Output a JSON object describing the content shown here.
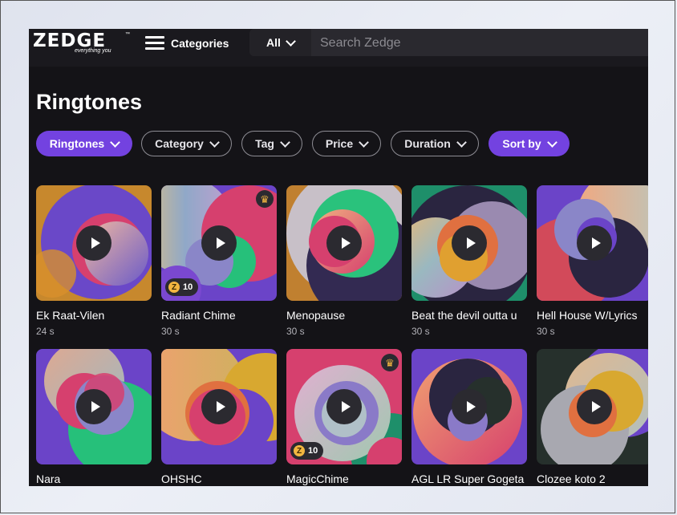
{
  "header": {
    "logo_text": "ZEDGE",
    "logo_tagline": "everything you",
    "logo_tm": "™",
    "categories_label": "Categories",
    "search_scope": "All",
    "search_placeholder": "Search Zedge"
  },
  "page": {
    "title": "Ringtones"
  },
  "filters": [
    "Ringtones",
    "Category",
    "Tag",
    "Price",
    "Duration",
    "Sort by"
  ],
  "colors": {
    "accent": "#7342e0",
    "background": "#141317",
    "coin": "#f2b640"
  },
  "items": [
    {
      "title": "Ek Raat-Vilen",
      "duration": "24 s",
      "premium": false,
      "coins": ""
    },
    {
      "title": "Radiant Chime",
      "duration": "30 s",
      "premium": true,
      "coins": "10"
    },
    {
      "title": "Menopause",
      "duration": "30 s",
      "premium": false,
      "coins": ""
    },
    {
      "title": "Beat the devil outta u",
      "duration": "30 s",
      "premium": false,
      "coins": ""
    },
    {
      "title": "Hell House W/Lyrics",
      "duration": "30 s",
      "premium": false,
      "coins": ""
    },
    {
      "title": "Nara",
      "duration": "",
      "premium": false,
      "coins": ""
    },
    {
      "title": "OHSHC",
      "duration": "",
      "premium": false,
      "coins": ""
    },
    {
      "title": "MagicChime",
      "duration": "",
      "premium": true,
      "coins": "10"
    },
    {
      "title": "AGL LR Super Gogeta",
      "duration": "",
      "premium": false,
      "coins": ""
    },
    {
      "title": "Clozee koto 2",
      "duration": "",
      "premium": false,
      "coins": ""
    }
  ]
}
